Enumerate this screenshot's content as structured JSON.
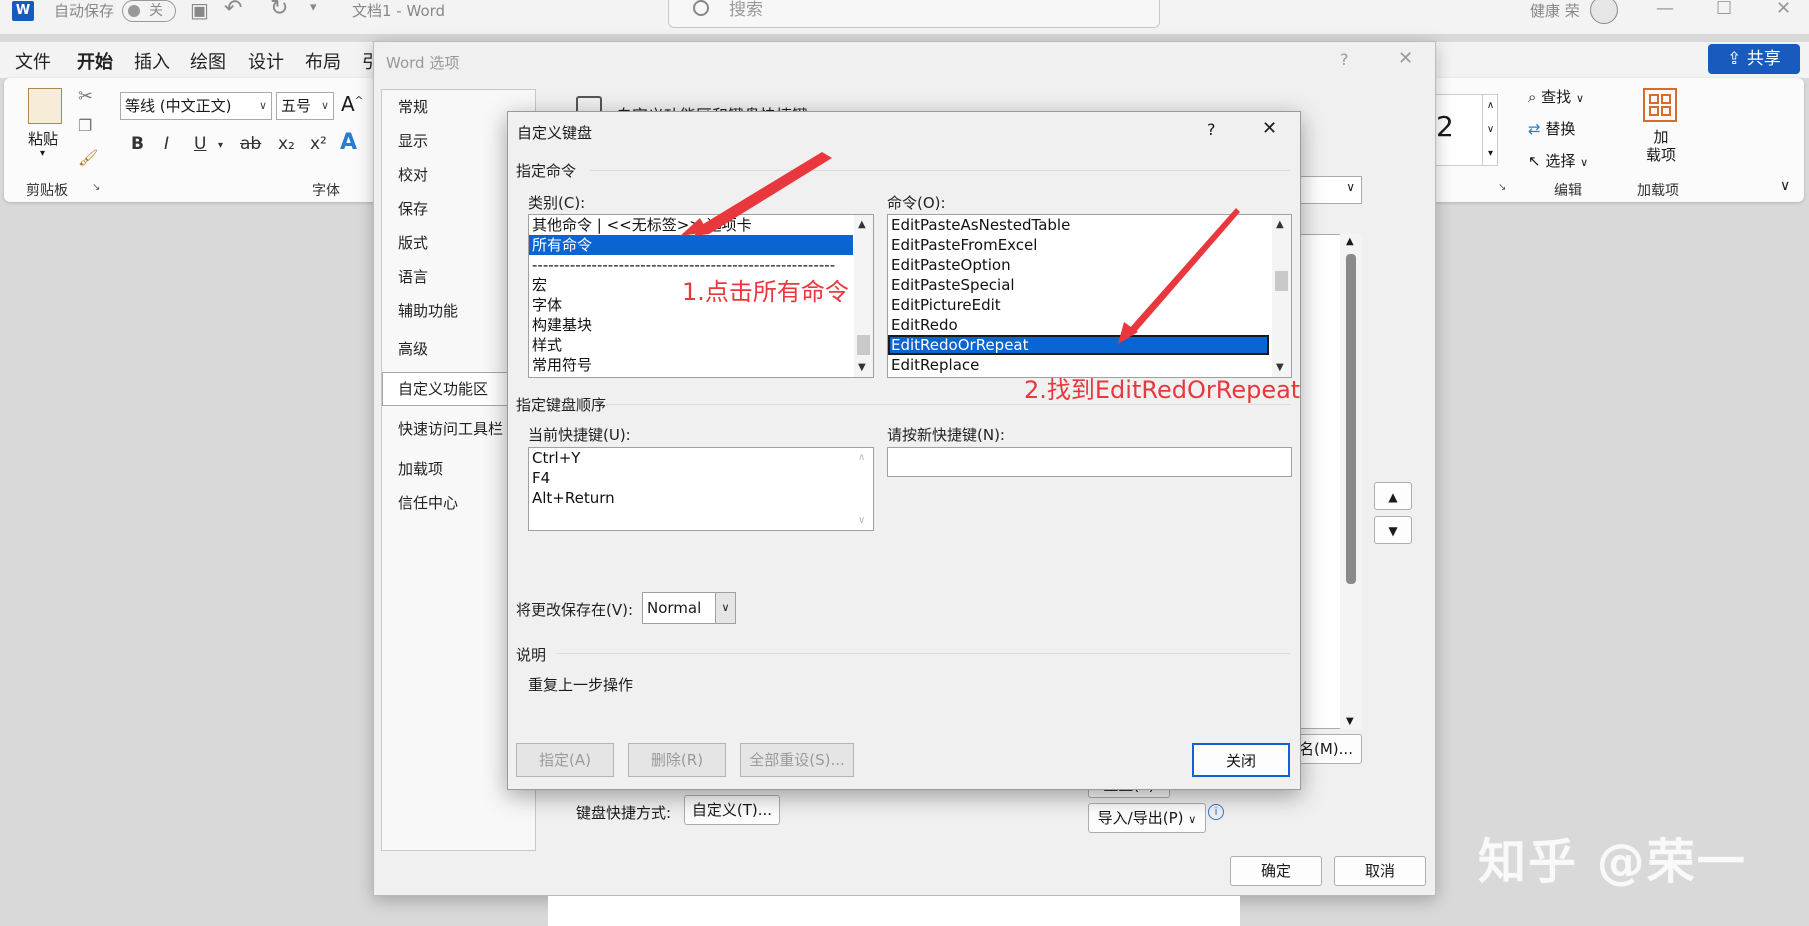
{
  "titlebar": {
    "autosave_label": "自动保存",
    "autosave_state": "关",
    "doc_title": "文档1  -  Word",
    "search_placeholder": "搜索",
    "user_name": "健康 荣"
  },
  "ribbon": {
    "tabs": [
      "文件",
      "开始",
      "插入",
      "绘图",
      "设计",
      "布局",
      "引"
    ],
    "active_tab": "开始",
    "share_label": "共享",
    "paste_label": "粘贴",
    "font_name": "等线 (中文正文)",
    "font_size": "五号",
    "grow_font_glyph": "A^",
    "bold": "B",
    "italic": "I",
    "underline": "U",
    "strike": "ab",
    "subscript": "x₂",
    "superscript": "x²",
    "text_effects": "A",
    "clipboard_group": "剪贴板",
    "font_group": "字体",
    "style_fragment": "2",
    "find_label": "查找",
    "replace_label": "替换",
    "select_label": "选择",
    "edit_group": "编辑",
    "addins_label": "加\n载项",
    "addins_group": "加载项"
  },
  "options_dialog": {
    "title": "Word 选项",
    "help": "?",
    "close": "✕",
    "header_fragment": "自定义功能区和键盘快捷键",
    "nav": [
      "常规",
      "显示",
      "校对",
      "保存",
      "版式",
      "语言",
      "辅助功能",
      "高级",
      "自定义功能区",
      "快速访问工具栏",
      "加载项",
      "信任中心"
    ],
    "nav_selected": "自定义功能区",
    "keyboard_label": "键盘快捷方式:",
    "customize_btn": "自定义(T)...",
    "rename_btn_fragment": "名(M)...",
    "reset_btn_fragment": "重置(E)",
    "import_export_btn": "导入/导出(P)",
    "ok_btn": "确定",
    "cancel_btn": "取消",
    "up_arrow": "▲",
    "down_arrow": "▼"
  },
  "kb_dialog": {
    "title": "自定义键盘",
    "help": "?",
    "close": "✕",
    "specify_command_section": "指定命令",
    "categories_label": "类别(C):",
    "categories": [
      "其他命令 | <<无标签>> 选项卡",
      "所有命令",
      "--------------------------------------------------------",
      "宏",
      "字体",
      "构建基块",
      "样式",
      "常用符号"
    ],
    "categories_selected_index": 1,
    "commands_label": "命令(O):",
    "commands": [
      "EditPasteAsNestedTable",
      "EditPasteFromExcel",
      "EditPasteOption",
      "EditPasteSpecial",
      "EditPictureEdit",
      "EditRedo",
      "EditRedoOrRepeat",
      "EditReplace"
    ],
    "commands_selected_index": 6,
    "key_sequence_section": "指定键盘顺序",
    "current_keys_label": "当前快捷键(U):",
    "current_keys": [
      "Ctrl+Y",
      "F4",
      "Alt+Return"
    ],
    "new_key_label": "请按新快捷键(N):",
    "new_key_value": "",
    "save_in_label": "将更改保存在(V):",
    "save_in_value": "Normal",
    "description_section": "说明",
    "description_text": "重复上一步操作",
    "assign_btn": "指定(A)",
    "remove_btn": "删除(R)",
    "reset_all_btn": "全部重设(S)...",
    "close_btn": "关闭"
  },
  "annotations": {
    "step1": "1.点击所有命令",
    "step2": "2.找到EditRedOrRepeat",
    "color": "#e8383d"
  },
  "watermark": "知乎 @荣一",
  "colors": {
    "accent": "#185abd",
    "selection": "#0a64d2"
  }
}
